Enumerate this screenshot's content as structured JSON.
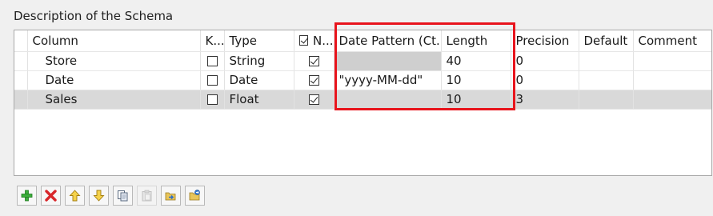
{
  "section": {
    "title": "Description of the Schema"
  },
  "columns": {
    "column": "Column",
    "key": "K...",
    "type": "Type",
    "nullable": "N...",
    "date_pattern": "Date Pattern (Ct...",
    "length": "Length",
    "precision": "Precision",
    "default": "Default",
    "comment": "Comment"
  },
  "rows": [
    {
      "column": "Store",
      "key": false,
      "type": "String",
      "nullable": true,
      "date_pattern": "",
      "length": "40",
      "precision": "0",
      "default": "",
      "comment": ""
    },
    {
      "column": "Date",
      "key": false,
      "type": "Date",
      "nullable": true,
      "date_pattern": "\"yyyy-MM-dd\"",
      "length": "10",
      "precision": "0",
      "default": "",
      "comment": ""
    },
    {
      "column": "Sales",
      "key": false,
      "type": "Float",
      "nullable": true,
      "date_pattern": "",
      "length": "10",
      "precision": "3",
      "default": "",
      "comment": "",
      "selected": true
    }
  ],
  "toolbar": [
    {
      "name": "add-button",
      "icon": "plus-icon",
      "enabled": true
    },
    {
      "name": "remove-button",
      "icon": "delete-x-icon",
      "enabled": true
    },
    {
      "name": "move-up-button",
      "icon": "arrow-up-icon",
      "enabled": true
    },
    {
      "name": "move-down-button",
      "icon": "arrow-down-icon",
      "enabled": true
    },
    {
      "name": "copy-button",
      "icon": "copy-icon",
      "enabled": true
    },
    {
      "name": "paste-button",
      "icon": "paste-icon",
      "enabled": false
    },
    {
      "name": "import-button",
      "icon": "import-icon",
      "enabled": true
    },
    {
      "name": "export-button",
      "icon": "export-icon",
      "enabled": true
    }
  ],
  "colors": {
    "highlight": "#e8141c",
    "selected_row": "#d9d9d9",
    "disabled_cell": "#cfcfcf"
  }
}
